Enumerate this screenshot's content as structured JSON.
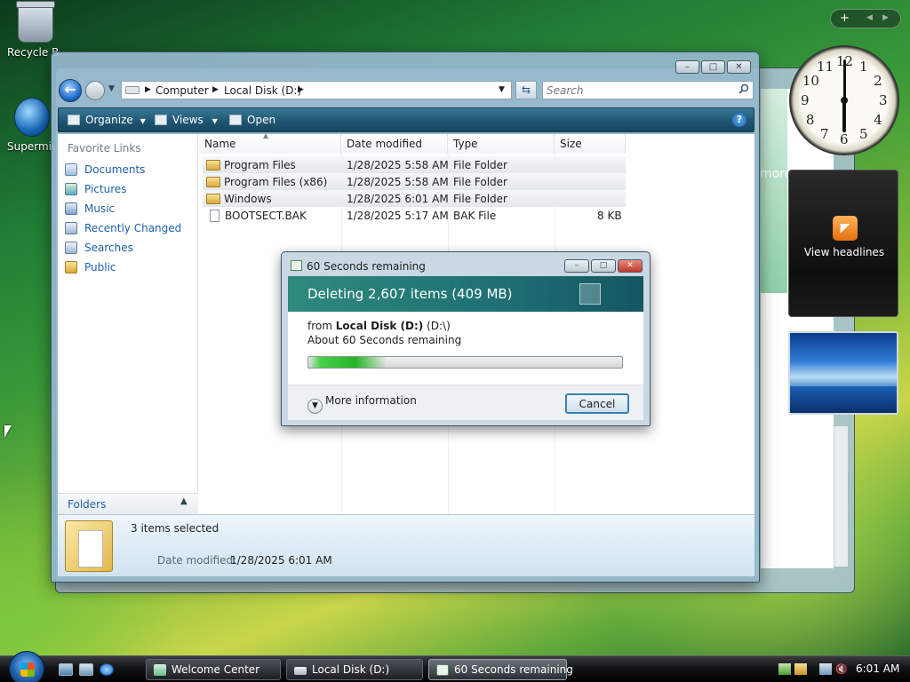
{
  "desktop": {
    "icons": [
      {
        "label": "Recycle Bin",
        "icon": "recycle-bin-icon"
      },
      {
        "label": "Supermicro",
        "icon": "supermicro-icon"
      }
    ]
  },
  "explorer": {
    "breadcrumb": [
      "Computer",
      "Local Disk (D:)"
    ],
    "search_placeholder": "Search",
    "toolbar": {
      "organize": "Organize",
      "views": "Views",
      "open": "Open"
    },
    "favorites_title": "Favorite Links",
    "favorites": [
      {
        "label": "Documents",
        "icon": "documents-icon"
      },
      {
        "label": "Pictures",
        "icon": "pictures-icon"
      },
      {
        "label": "Music",
        "icon": "music-icon"
      },
      {
        "label": "Recently Changed",
        "icon": "recently-changed-icon"
      },
      {
        "label": "Searches",
        "icon": "searches-icon"
      },
      {
        "label": "Public",
        "icon": "public-folder-icon"
      }
    ],
    "folders_label": "Folders",
    "columns": [
      "Name",
      "Date modified",
      "Type",
      "Size"
    ],
    "files": [
      {
        "name": "Program Files",
        "date": "1/28/2025 5:58 AM",
        "type": "File Folder",
        "size": "",
        "selected": true
      },
      {
        "name": "Program Files (x86)",
        "date": "1/28/2025 5:58 AM",
        "type": "File Folder",
        "size": "",
        "selected": true
      },
      {
        "name": "Windows",
        "date": "1/28/2025 6:01 AM",
        "type": "File Folder",
        "size": "",
        "selected": true
      },
      {
        "name": "BOOTSECT.BAK",
        "date": "1/28/2025 5:17 AM",
        "type": "BAK File",
        "size": "8 KB",
        "selected": false
      }
    ],
    "details": {
      "selection": "3 items selected",
      "date_label": "Date modified:",
      "date_value": "1/28/2025 6:01 AM"
    }
  },
  "dialog": {
    "title": "60 Seconds remaining",
    "banner": "Deleting 2,607 items (409 MB)",
    "from_prefix": "from",
    "from_bold": "Local Disk (D:)",
    "from_path": "(D:\\)",
    "about": "About 60 Seconds remaining",
    "progress_fraction": 0.25,
    "more_info": "More information",
    "cancel": "Cancel"
  },
  "background_window": {
    "partial_text": "more"
  },
  "gadgets": {
    "clock": {
      "numbers": [
        "12",
        "1",
        "2",
        "3",
        "4",
        "5",
        "6",
        "7",
        "8",
        "9",
        "10",
        "11"
      ],
      "time": "6:01"
    },
    "feed": {
      "label": "View headlines",
      "icon": "rss-icon"
    },
    "sidebar_add": "+"
  },
  "taskbar": {
    "tasks": [
      {
        "label": "Welcome Center",
        "active": false
      },
      {
        "label": "Local Disk (D:)",
        "active": false
      },
      {
        "label": "60 Seconds remaining",
        "active": true
      }
    ],
    "clock": "6:01 AM"
  },
  "colors": {
    "accent": "#1e5ea8",
    "toolbar": "#1f5673",
    "progress": "#25b325",
    "banner": "#1e6f73"
  }
}
